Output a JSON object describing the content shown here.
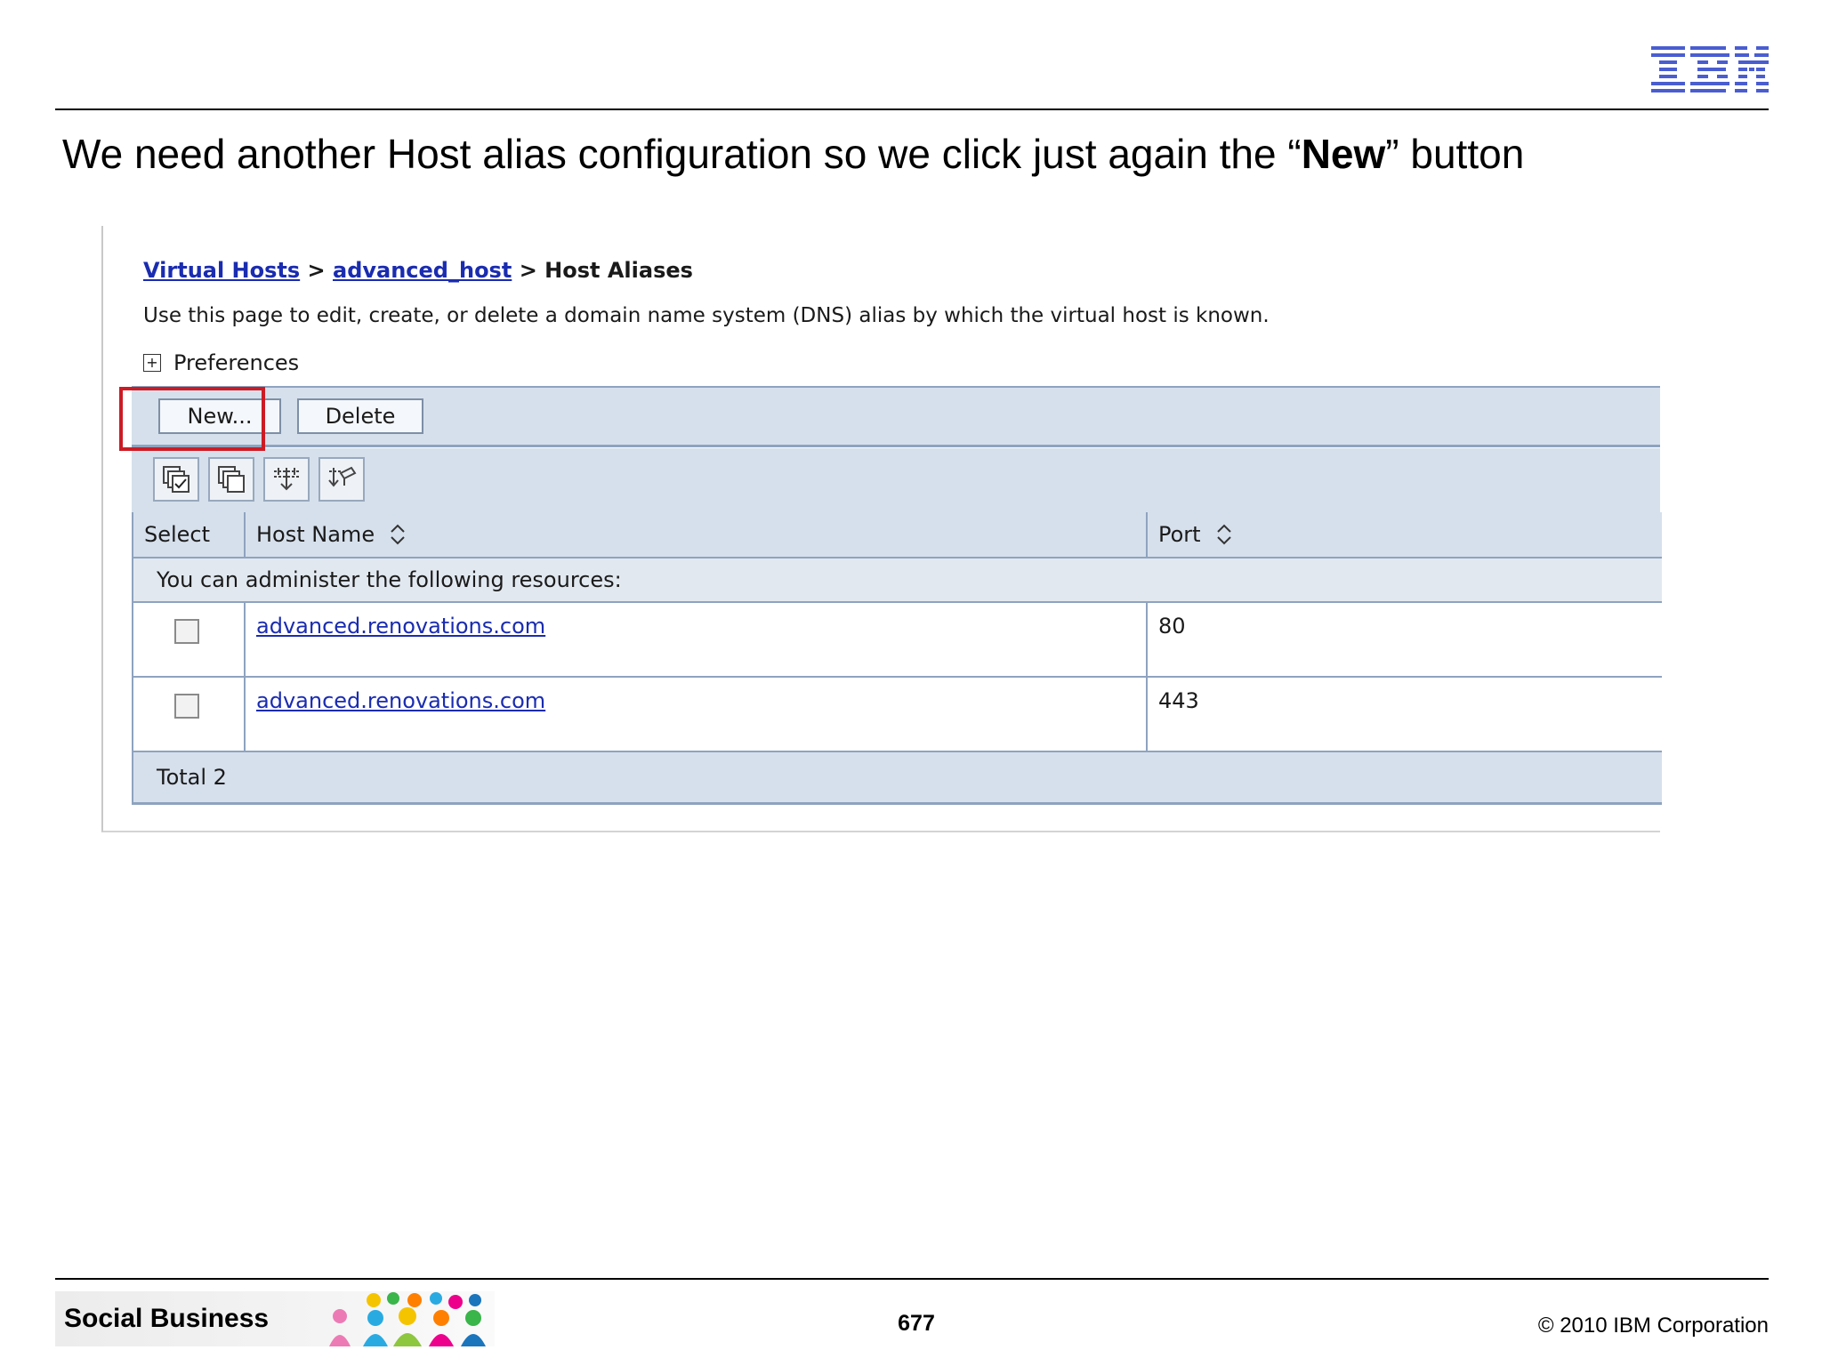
{
  "slide": {
    "logo_text": "IBM",
    "title_prefix": "We need another Host alias configuration so we click just again the “",
    "title_bold": "New",
    "title_suffix": "” button"
  },
  "console": {
    "breadcrumb": {
      "link1": "Virtual Hosts",
      "sep1": ">",
      "link2": "advanced_host",
      "sep2": ">",
      "current": "Host Aliases"
    },
    "description": "Use this page to edit, create, or delete a domain name system (DNS) alias by which the virtual host is known.",
    "preferences_label": "Preferences",
    "preferences_expand": "+",
    "buttons": {
      "new_label": "New...",
      "delete_label": "Delete"
    },
    "icon_buttons": [
      "select-all-icon",
      "deselect-all-icon",
      "show-filter-icon",
      "clear-filter-icon"
    ],
    "table": {
      "headers": {
        "select": "Select",
        "host_name": "Host Name",
        "port": "Port"
      },
      "resource_note": "You can administer the following resources:",
      "rows": [
        {
          "host_name": "advanced.renovations.com",
          "port": "80",
          "selected": false
        },
        {
          "host_name": "advanced.renovations.com",
          "port": "443",
          "selected": false
        }
      ],
      "total": "Total 2"
    },
    "colors": {
      "panel_bg": "#d6e0ec",
      "border": "#8ea3bf",
      "link": "#1a2cb0",
      "highlight": "#cc1b24"
    }
  },
  "footer": {
    "banner_text": "Social Business",
    "page_number": "677",
    "copyright": "© 2010 IBM Corporation"
  }
}
